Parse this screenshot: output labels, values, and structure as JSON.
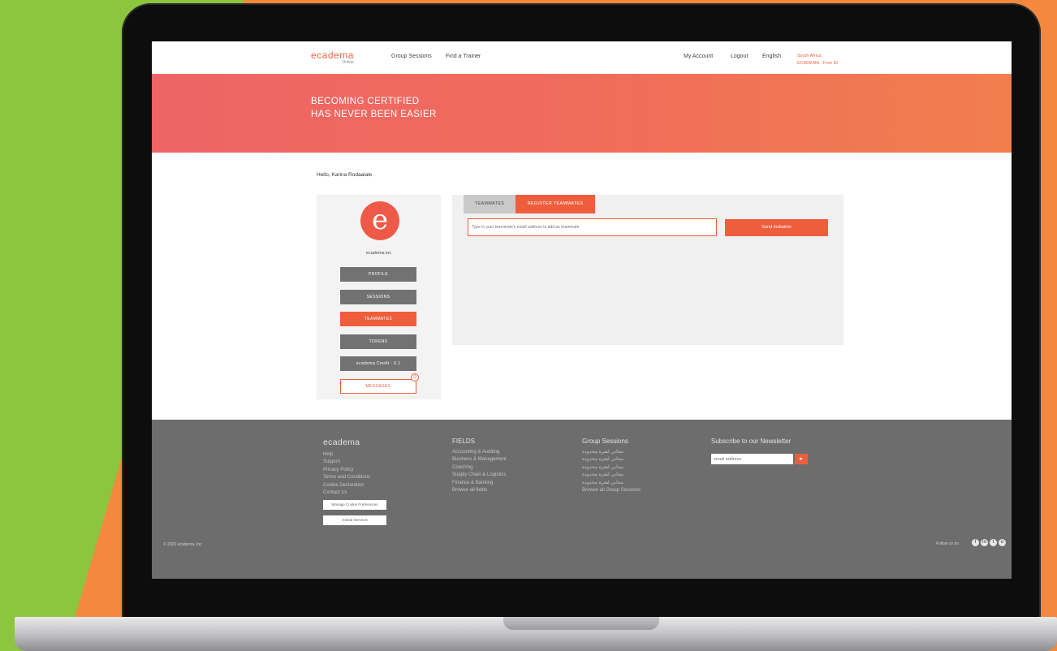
{
  "header": {
    "logo_name": "ecadema",
    "logo_sub": "Online",
    "nav": [
      "Group Sessions",
      "Find a Trainer"
    ],
    "right_nav": [
      "My Account",
      "Logout",
      "English"
    ],
    "small_line1": "South Africa",
    "small_line2": "ECADEMA - Free ID"
  },
  "hero": {
    "line1": "BECOMING CERTIFIED",
    "line2": "HAS NEVER BEEN EASIER"
  },
  "greeting": "Hello, Karina Rodaaiale",
  "side_panel": {
    "company": "ecadema inc",
    "buttons": [
      "PROFILE",
      "SESSIONS",
      "TEAMMATES",
      "TOKENS",
      "ecadema Credit : 0.1",
      "MESSAGES"
    ],
    "active_index": 2,
    "message_badge": "0"
  },
  "main_panel": {
    "tabs": [
      "TEAMMATES",
      "REGISTER TEAMMATES"
    ],
    "active_tab": 1,
    "email_placeholder": "Type in your teammate's email address to add as teammate",
    "send_label": "Send Invitation"
  },
  "footer": {
    "col1": {
      "head": "ecadema",
      "items": [
        "Help",
        "Support",
        "Privacy Policy",
        "Terms and Conditions",
        "Cookie Declaration",
        "Contact Us"
      ],
      "btn1": "Manage Cookie Preferences",
      "btn2": "Global Services"
    },
    "col2": {
      "head": "FIELDS",
      "items": [
        "Accounting & Auditing",
        "Business & Management",
        "Coaching",
        "Supply Chain & Logistics",
        "Finance & Banking",
        "Browse all fields"
      ]
    },
    "col3": {
      "head": "Group Sessions",
      "items": [
        "مجاني لفترة محدودة",
        "مجاني لفترة محدودة",
        "مجاني لفترة محدودة",
        "مجاني لفترة محدودة",
        "مجاني لفترة محدودة",
        "Browse all Group Sessions"
      ]
    },
    "newsletter": {
      "head": "Subscribe to our Newsletter",
      "placeholder": "email address",
      "button": "▸"
    },
    "copyright": "© 2020 ecadema, Inc",
    "follow": "Follow us on",
    "social": [
      "f",
      "in",
      "t",
      "o"
    ]
  },
  "colors": {
    "accent": "#ef5e3c",
    "footer_bg": "#6d6d6d",
    "background_left": "#8cc63e",
    "background_right": "#f5883f"
  }
}
